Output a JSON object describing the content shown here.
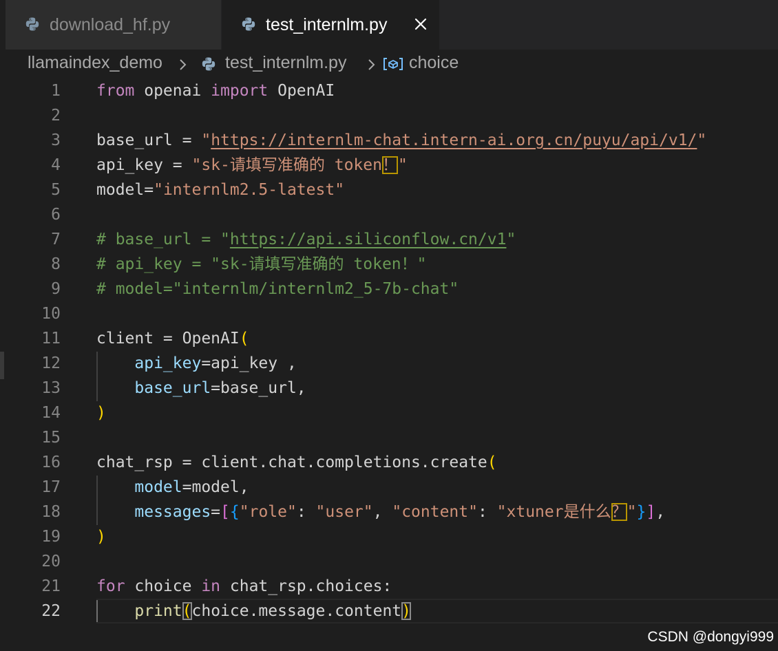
{
  "tabs": [
    {
      "label": "download_hf.py",
      "icon": "python-file-icon",
      "active": false
    },
    {
      "label": "test_internlm.py",
      "icon": "python-file-icon",
      "active": true
    }
  ],
  "breadcrumb": {
    "folder": "llamaindex_demo",
    "file": "test_internlm.py",
    "symbol": "choice"
  },
  "code": {
    "current_line": 22,
    "line_numbers": [
      "1",
      "2",
      "3",
      "4",
      "5",
      "6",
      "7",
      "8",
      "9",
      "10",
      "11",
      "12",
      "13",
      "14",
      "15",
      "16",
      "17",
      "18",
      "19",
      "20",
      "21",
      "22"
    ],
    "l1": {
      "kw1": "from",
      "mod": " openai ",
      "kw2": "import",
      "name": " OpenAI"
    },
    "l3": {
      "var": "base_url = ",
      "q1": "\"",
      "url": "https://internlm-chat.intern-ai.org.cn/puyu/api/v1/",
      "q2": "\""
    },
    "l4": {
      "var": "api_key = ",
      "str1": "\"sk-请填写准确的 token",
      "bang": "！",
      "q2": "\""
    },
    "l5": {
      "var": "model=",
      "str": "\"internlm2.5-latest\""
    },
    "l7": {
      "pre": "# base_url = \"",
      "url": "https://api.siliconflow.cn/v1",
      "post": "\""
    },
    "l8": {
      "text": "# api_key = \"sk-请填写准确的 token！\""
    },
    "l9": {
      "text": "# model=\"internlm/internlm2_5-7b-chat\""
    },
    "l11": {
      "text": "client = OpenAI",
      "paren": "("
    },
    "l12": {
      "param": "api_key",
      "rest": "=api_key ,"
    },
    "l13": {
      "param": "base_url",
      "rest": "=base_url,"
    },
    "l14": {
      "paren": ")"
    },
    "l16": {
      "text": "chat_rsp = client.chat.completions.",
      "fn": "create",
      "paren": "("
    },
    "l17": {
      "param": "model",
      "rest": "=model,"
    },
    "l18": {
      "param": "messages",
      "eq": "=",
      "b1": "[",
      "b2": "{",
      "k1": "\"role\"",
      "c1": ": ",
      "v1": "\"user\"",
      "c2": ", ",
      "k2": "\"content\"",
      "c3": ": ",
      "v2a": "\"xtuner是什么",
      "qm": "？",
      "v2b": "\"",
      "b3": "}",
      "b4": "]",
      "end": ","
    },
    "l19": {
      "paren": ")"
    },
    "l21": {
      "kw1": "for",
      "var": " choice ",
      "kw2": "in",
      "rest": " chat_rsp.choices:"
    },
    "l22": {
      "fn": "print",
      "p1": "(",
      "arg": "choice.message.content",
      "p2": ")"
    }
  },
  "watermark": "CSDN @dongyi999",
  "colors": {
    "keyword": "#c586c0",
    "string": "#ce9178",
    "comment": "#6a9955",
    "parameter": "#9cdcfe",
    "function": "#dcdcaa",
    "bracket_gold": "#ffd700",
    "bracket_orchid": "#da70d6",
    "bracket_blue": "#179fff"
  }
}
